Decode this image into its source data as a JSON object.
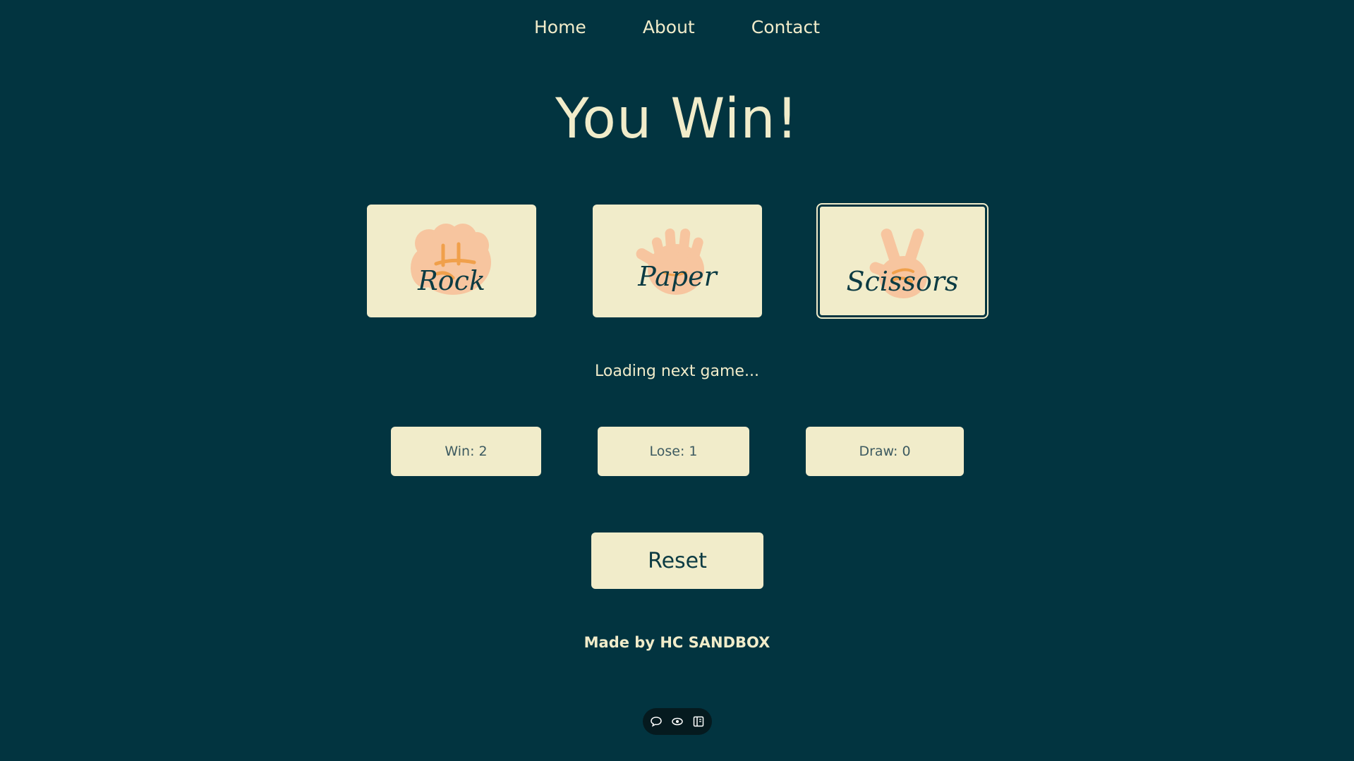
{
  "nav": {
    "items": [
      {
        "label": "Home"
      },
      {
        "label": "About"
      },
      {
        "label": "Contact"
      }
    ]
  },
  "game": {
    "result_title": "You Win!",
    "choices": [
      {
        "label": "Rock",
        "icon": "fist-icon",
        "selected": false
      },
      {
        "label": "Paper",
        "icon": "open-hand-icon",
        "selected": false
      },
      {
        "label": "Scissors",
        "icon": "peace-hand-icon",
        "selected": true
      }
    ],
    "status": "Loading next game...",
    "scores": {
      "win": "Win: 2",
      "lose": "Lose: 1",
      "draw": "Draw: 0"
    },
    "reset_label": "Reset"
  },
  "footer": {
    "text": "Made by HC SANDBOX"
  },
  "toolbar": {
    "icons": [
      "comment-icon",
      "eye-icon",
      "layout-icon"
    ]
  },
  "colors": {
    "background": "#023440",
    "card": "#f1ecca",
    "hand": "#f7c59f",
    "hand_line": "#f0a04b",
    "text_dark": "#0c3b43"
  }
}
